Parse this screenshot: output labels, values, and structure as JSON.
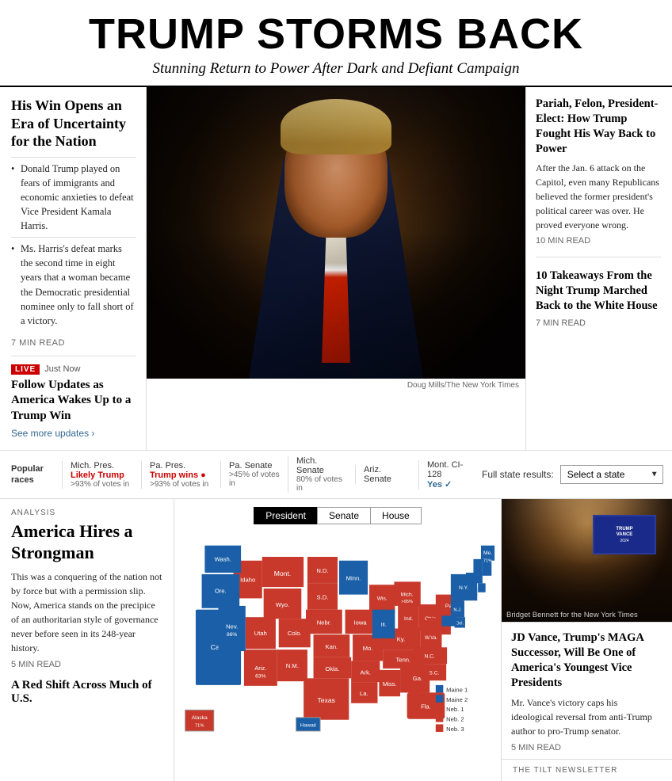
{
  "header": {
    "main_title": "TRUMP STORMS BACK",
    "subtitle": "Stunning Return to Power After Dark and Defiant Campaign"
  },
  "left_col": {
    "headline": "His Win Opens an Era of Uncertainty for the Nation",
    "bullets": [
      "Donald Trump played on fears of immigrants and economic anxieties to defeat Vice President Kamala Harris.",
      "Ms. Harris's defeat marks the second time in eight years that a woman became the Democratic presidential nominee only to fall short of a victory."
    ],
    "read_time": "7 MIN READ",
    "live": {
      "badge": "LIVE",
      "just_now": "Just Now",
      "headline": "Follow Updates as America Wakes Up to a Trump Win",
      "see_more": "See more updates ›"
    }
  },
  "photo": {
    "caption": "Doug Mills/The New York Times"
  },
  "right_col": {
    "stories": [
      {
        "headline": "Pariah, Felon, President-Elect: How Trump Fought His Way Back to Power",
        "body": "After the Jan. 6 attack on the Capitol, even many Republicans believed the former president's political career was over. He proved everyone wrong.",
        "read_time": "10 MIN READ"
      },
      {
        "headline": "10 Takeaways From the Night Trump Marched Back to the White House",
        "read_time": "7 MIN READ"
      }
    ]
  },
  "races_bar": {
    "label": "Popular races",
    "races": [
      {
        "name": "Mich. Pres.",
        "status": "Likely Trump",
        "status_color": "trump",
        "votes": ">93% of votes in"
      },
      {
        "name": "Pa. Pres.",
        "status": "Trump wins ●",
        "status_color": "trump",
        "votes": ">93% of votes in"
      },
      {
        "name": "Pa. Senate",
        "status": "",
        "status_color": "",
        "votes": ">45% of votes in"
      },
      {
        "name": "Mich. Senate",
        "status": "",
        "status_color": "",
        "votes": "80% of votes in"
      },
      {
        "name": "Ariz. Senate",
        "status": "",
        "status_color": "",
        "votes": ""
      },
      {
        "name": "Mont. CI-128",
        "status": "Yes ✓",
        "status_color": "yes",
        "votes": ""
      }
    ],
    "full_results_label": "Full state results:",
    "select_placeholder": "Select a state"
  },
  "analysis": {
    "label": "ANALYSIS",
    "headline": "America Hires a Strongman",
    "body": "This was a conquering of the nation not by force but with a permission slip. Now, America stands on the precipice of an authoritarian style of governance never before seen in its 248-year history.",
    "read_time": "5 MIN READ",
    "red_shift": "A Red Shift Across Much of U.S."
  },
  "map": {
    "tabs": [
      "President",
      "Senate",
      "House"
    ],
    "active_tab": "President",
    "alaska_label": "Alaska\n71%",
    "hawaii_label": "Hawaii",
    "maine_label": "Maine\n71%",
    "legend": [
      {
        "color": "#1a5fa8",
        "label": "Maine 1"
      },
      {
        "color": "#1a5fa8",
        "label": "Maine 2"
      },
      {
        "color": "#cc2200",
        "label": "Neb. 1"
      },
      {
        "color": "#cc2200",
        "label": "Neb. 2"
      },
      {
        "color": "#cc2200",
        "label": "Neb. 3"
      }
    ]
  },
  "vance": {
    "img_caption": "Bridget Bennett for the New York Times",
    "headline": "JD Vance, Trump's MAGA Successor, Will Be One of America's Youngest Vice Presidents",
    "body": "Mr. Vance's victory caps his ideological reversal from anti-Trump author to pro-Trump senator.",
    "read_time": "5 MIN READ"
  },
  "tilt": {
    "label": "THE TILT NEWSLETTER"
  }
}
